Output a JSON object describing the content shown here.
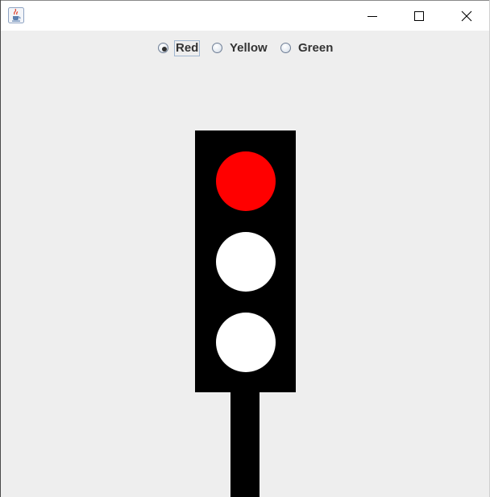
{
  "window": {
    "icon": "java-coffee-icon",
    "controls": {
      "minimize_icon": "minimize-icon",
      "maximize_icon": "maximize-icon",
      "close_icon": "close-icon"
    }
  },
  "radio_group": {
    "options": [
      {
        "label": "Red",
        "selected": true
      },
      {
        "label": "Yellow",
        "selected": false
      },
      {
        "label": "Green",
        "selected": false
      }
    ]
  },
  "traffic_light": {
    "state": "Red",
    "housing_color": "#000000",
    "lamp_off_color": "#ffffff",
    "lamps": [
      {
        "name": "red",
        "on": true,
        "on_color": "#ff0000"
      },
      {
        "name": "yellow",
        "on": false,
        "on_color": "#ffff00"
      },
      {
        "name": "green",
        "on": false,
        "on_color": "#00ff00"
      }
    ]
  }
}
